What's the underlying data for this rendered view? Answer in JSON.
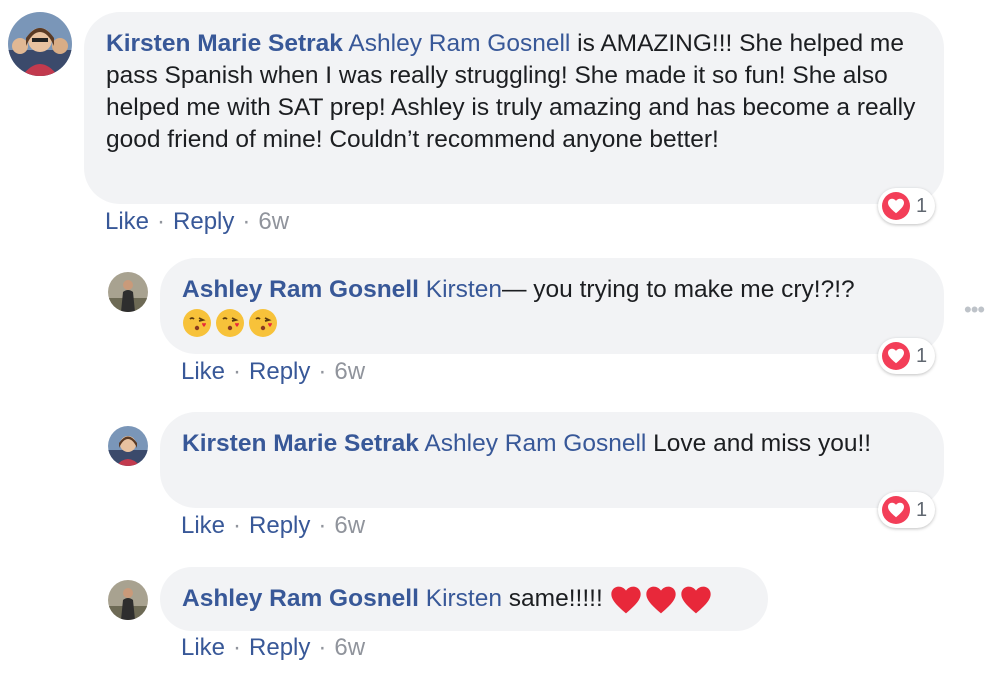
{
  "comments": [
    {
      "author": "Kirsten Marie Setrak",
      "mention": "Ashley Ram Gosnell",
      "text": " is AMAZING!!! She helped me pass Spanish when I was really struggling! She made it so fun! She also helped me with SAT prep! Ashley is truly amazing and has become a really good friend of mine! Couldn’t recommend anyone better!",
      "like_label": "Like",
      "reply_label": "Reply",
      "age": "6w",
      "reaction_count": "1"
    },
    {
      "author": "Ashley Ram Gosnell",
      "mention": "Kirsten",
      "text": "— you trying to make me cry!?!?",
      "emoji": [
        "face-blowing-kiss",
        "face-blowing-kiss",
        "face-blowing-kiss"
      ],
      "like_label": "Like",
      "reply_label": "Reply",
      "age": "6w",
      "reaction_count": "1"
    },
    {
      "author": "Kirsten Marie Setrak",
      "mention": "Ashley Ram Gosnell",
      "text": " Love and miss you!!",
      "like_label": "Like",
      "reply_label": "Reply",
      "age": "6w",
      "reaction_count": "1"
    },
    {
      "author": "Ashley Ram Gosnell",
      "mention": "Kirsten",
      "text": " same!!!!!",
      "emoji": [
        "red-heart",
        "red-heart",
        "red-heart"
      ],
      "like_label": "Like",
      "reply_label": "Reply",
      "age": "6w"
    }
  ],
  "more_options_icon": "•••",
  "colors": {
    "link": "#385898",
    "bubble": "#f2f3f5",
    "muted": "#90949c",
    "love": "#f33e58"
  }
}
